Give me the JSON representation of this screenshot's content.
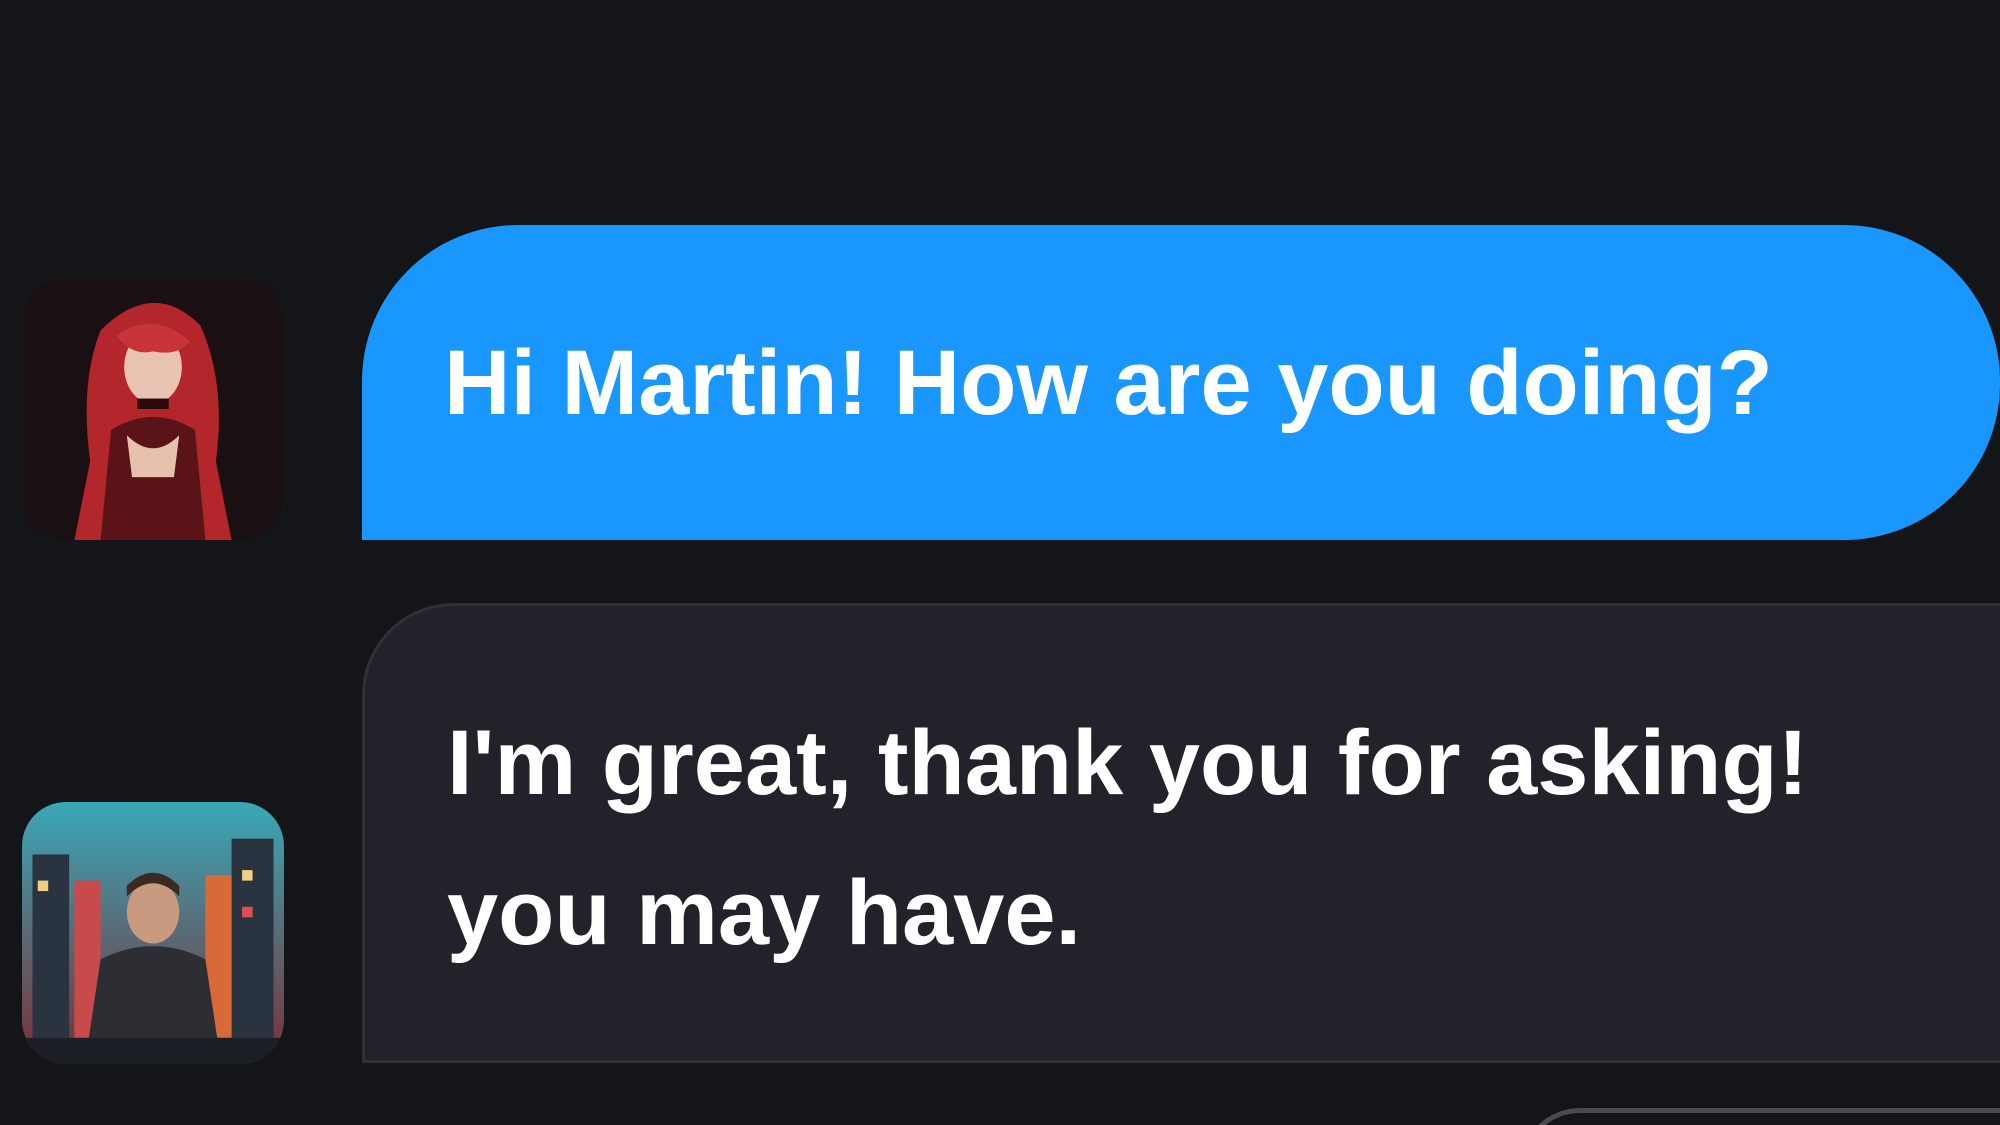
{
  "messages": [
    {
      "sender": "user",
      "avatar_icon": "red-haired-woman-avatar",
      "text": "Hi Martin! How are you doing?",
      "bubble_color": "#1a97ff"
    },
    {
      "sender": "bot",
      "avatar_icon": "man-in-city-avatar",
      "text": "I'm great, thank you for asking!\nyou may have.",
      "bubble_color": "#22232a"
    }
  ],
  "colors": {
    "background": "#141519",
    "user_bubble": "#1a97ff",
    "bot_bubble": "#22232a",
    "text": "#ffffff"
  }
}
